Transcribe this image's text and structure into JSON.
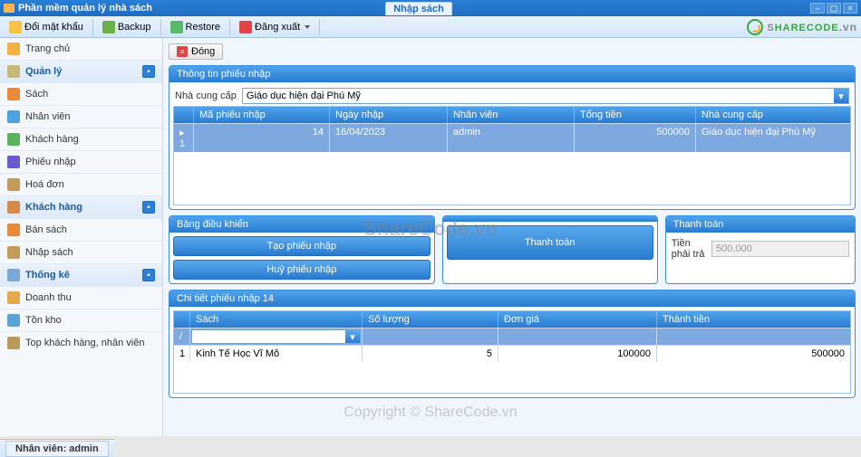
{
  "title": "Phần mềm quản lý nhà sách",
  "tab_active": "Nhập sách",
  "toolbar": {
    "change_password": "Đổi mật khẩu",
    "backup": "Backup",
    "restore": "Restore",
    "logout": "Đăng xuất"
  },
  "brand": {
    "name": "SHARECODE",
    "suffix": ".vn"
  },
  "sidebar": {
    "home": "Trang chủ",
    "manage_header": "Quản lý",
    "manage_items": [
      "Sách",
      "Nhân viên",
      "Khách hàng",
      "Phiếu nhập",
      "Hoá đơn"
    ],
    "customer_header": "Khách hàng",
    "customer_items": [
      "Bán sách",
      "Nhập sách"
    ],
    "stats_header": "Thống kê",
    "stats_items": [
      "Doanh thu",
      "Tồn kho",
      "Top khách hàng, nhân viên"
    ]
  },
  "close_label": "Đóng",
  "panel_info_title": "Thông tin phiếu nhập",
  "supplier_label": "Nhà cung cấp",
  "supplier_value": "Giáo dục hiện đại Phú Mỹ",
  "grid1": {
    "headers": {
      "h1": "",
      "h2": "Mã phiếu nhập",
      "h3": "Ngày nhập",
      "h4": "Nhân viên",
      "h5": "Tổng tiền",
      "h6": "Nhà cung cấp"
    },
    "row": {
      "lead": "▸ 1",
      "id": "14",
      "date": "16/04/2023",
      "staff": "admin",
      "total": "500000",
      "supplier": "Giáo dục hiện đại Phú Mỹ"
    }
  },
  "ctrl_panel_title": "Bảng điều khiển",
  "ctrl_panel_title_empty": "",
  "pay_panel_title": "Thanh toán",
  "btn_create": "Tạo phiếu nhập",
  "btn_cancel": "Huỷ phiếu nhập",
  "btn_pay": "Thanh toán",
  "pay_label": "Tiền phải trả",
  "pay_value": "500,000",
  "detail_title": "Chi tiết phiếu nhập 14",
  "grid2": {
    "headers": {
      "h1": "",
      "h2": "Sách",
      "h3": "Số lượng",
      "h4": "Đơn giá",
      "h5": "Thành tiền"
    },
    "input_row": {
      "lead": "/",
      "book": ""
    },
    "row": {
      "lead": "1",
      "book": "Kinh Tế Học Vĩ Mô",
      "qty": "5",
      "price": "100000",
      "amount": "500000"
    }
  },
  "status_prefix": "Nhân viên: ",
  "status_user": "admin",
  "watermark1": "ShareCode.vn",
  "watermark2": "Copyright © ShareCode.vn"
}
